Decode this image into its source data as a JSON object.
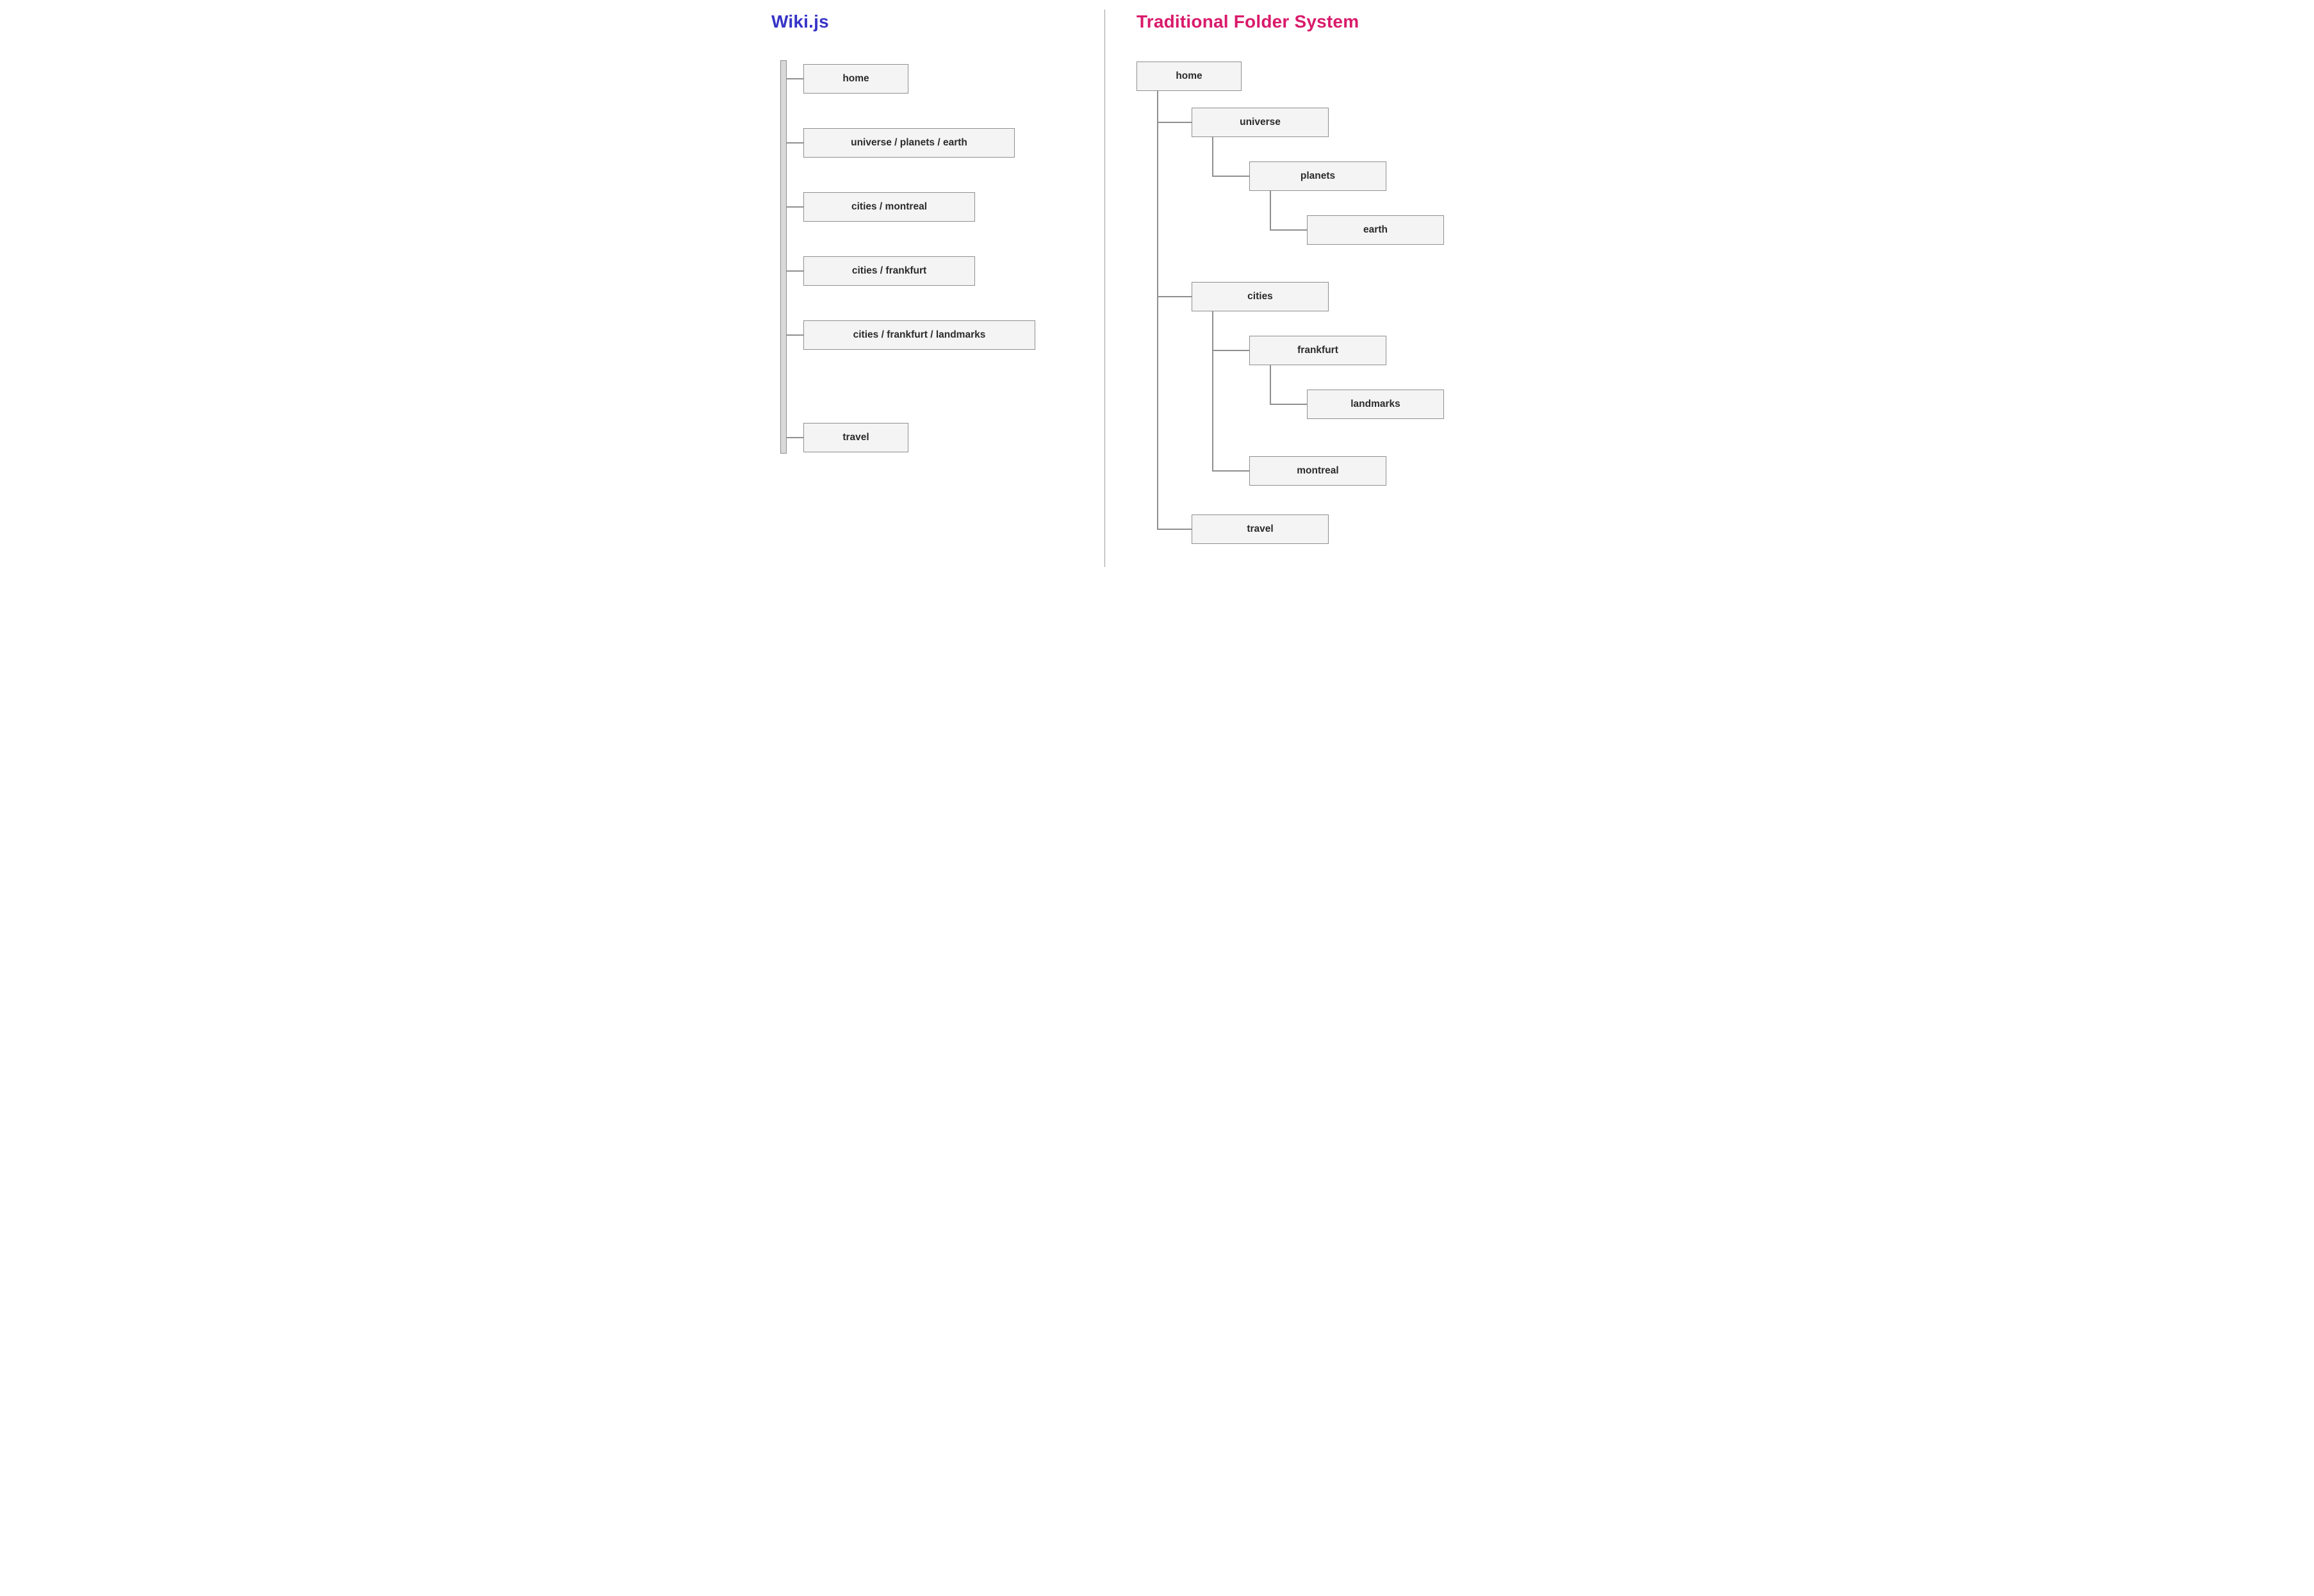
{
  "left": {
    "title": "Wiki.js",
    "items": [
      "home",
      "universe / planets / earth",
      "cities / montreal",
      "cities / frankfurt",
      "cities / frankfurt / landmarks",
      "travel"
    ]
  },
  "right": {
    "title": "Traditional Folder System",
    "nodes": {
      "home": "home",
      "universe": "universe",
      "planets": "planets",
      "earth": "earth",
      "cities": "cities",
      "frankfurt": "frankfurt",
      "landmarks": "landmarks",
      "montreal": "montreal",
      "travel": "travel"
    }
  },
  "colors": {
    "left_title": "#3734c7",
    "right_title": "#d91a6b",
    "node_fill": "#f4f4f4",
    "node_border": "#8f8f8f",
    "connector": "#8f8f8f"
  }
}
